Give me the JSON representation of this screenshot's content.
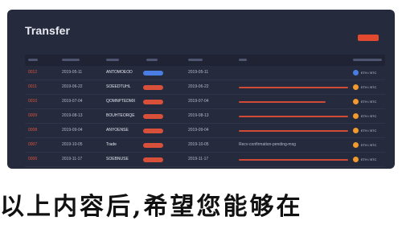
{
  "window": {
    "title": "Transfer"
  },
  "rows": [
    {
      "num": "0012",
      "date": "2019-05-11",
      "token": "ANTOMOEOD",
      "status": "blue",
      "bar_frac": 0.0,
      "text": ""
    },
    {
      "num": "0011",
      "date": "2019-06-22",
      "token": "SOEEDTUHL",
      "status": "red",
      "bar_frac": 0.34,
      "text": ""
    },
    {
      "num": "0010",
      "date": "2019-07-04",
      "token": "QOMNPTEDMX",
      "status": "red",
      "bar_frac": 0.27,
      "text": ""
    },
    {
      "num": "0009",
      "date": "2019-08-13",
      "token": "BOUHTEORQE",
      "status": "red",
      "bar_frac": 0.34,
      "text": ""
    },
    {
      "num": "0008",
      "date": "2019-09-04",
      "token": "ANYOENSE",
      "status": "red",
      "bar_frac": 0.34,
      "text": ""
    },
    {
      "num": "0007",
      "date": "2019-10-05",
      "token": "Trade",
      "status": "red",
      "bar_frac": 0.0,
      "text": "Recv-confirmation-pending-msg"
    },
    {
      "num": "0006",
      "date": "2019-11-17",
      "token": "SOEBNUSE",
      "status": "red",
      "bar_frac": 0.34,
      "text": ""
    },
    {
      "num": "0005",
      "date": "2019-12-02",
      "token": "Sonic Bond",
      "status": "red",
      "bar_frac": 0.34,
      "text": ""
    }
  ],
  "row_symbols": [
    "ETH / BTC",
    "ETH / BTC",
    "ETH / BTC",
    "ETH / BTC",
    "ETH / BTC",
    "ETH / BTC",
    "ETH / BTC",
    "ETH / BTC"
  ],
  "banner": {
    "text": "以上内容后,希望您能够在"
  },
  "colors": {
    "panel": "#262a3d",
    "accent_red": "#e3492f",
    "accent_blue": "#4a7de4",
    "accent_orange": "#f29a2e"
  }
}
